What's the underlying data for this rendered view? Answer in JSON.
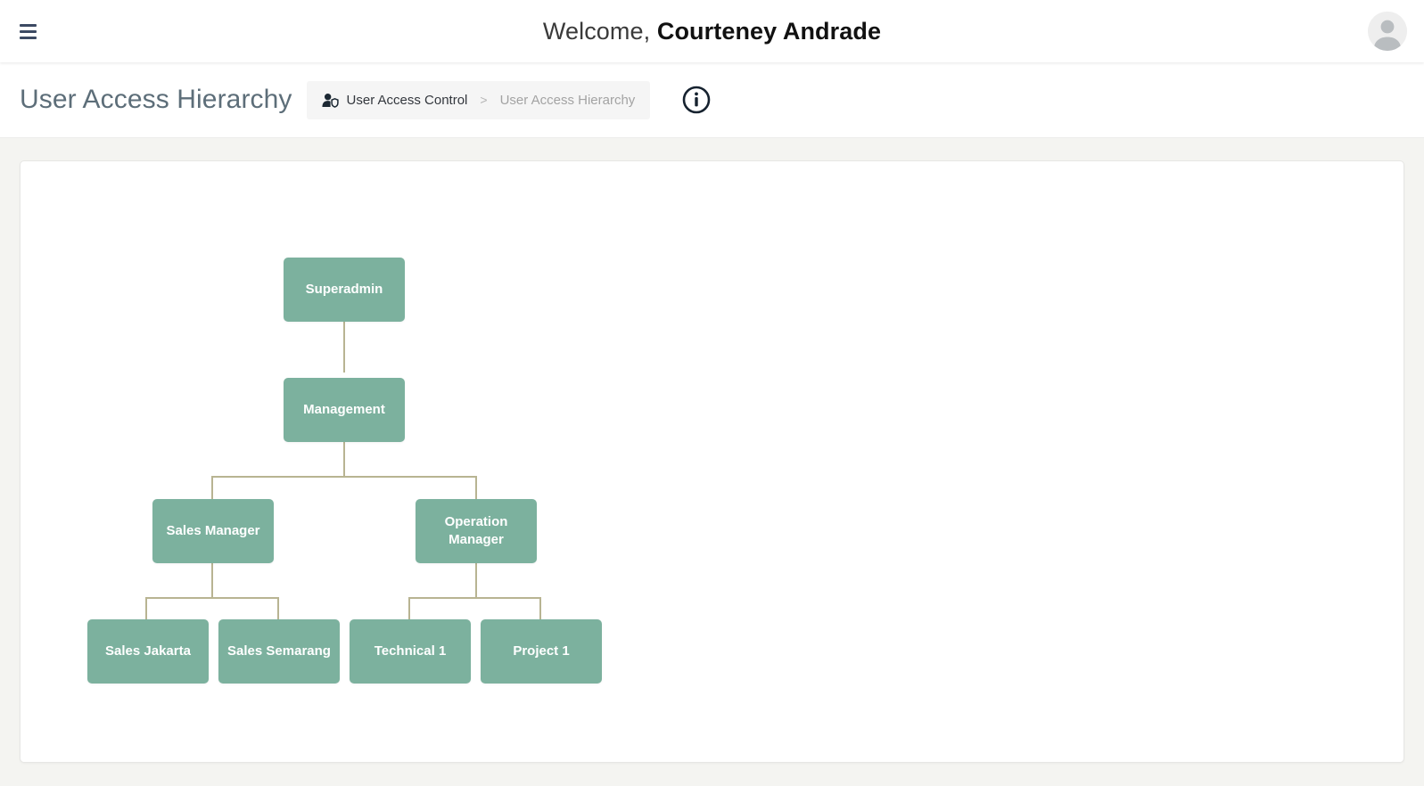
{
  "header": {
    "menu_icon": "hamburger-menu-icon",
    "welcome_prefix": "Welcome,",
    "user_name": "Courteney Andrade",
    "avatar_icon": "user-avatar-icon"
  },
  "subheader": {
    "page_title": "User Access Hierarchy",
    "breadcrumb": {
      "icon": "user-shield-icon",
      "parent": "User Access Control",
      "separator": ">",
      "current": "User Access Hierarchy"
    },
    "info_icon": "info-circle-icon"
  },
  "colors": {
    "node_fill": "#7cb19e",
    "node_text": "#ffffff",
    "connector": "#b8b492",
    "page_background": "#f4f4f1",
    "title_text": "#5d6e79",
    "menu_icon": "#3c4a63"
  },
  "chart_data": {
    "type": "diagram",
    "title": "User Access Hierarchy",
    "orientation": "top-down",
    "nodes": [
      {
        "id": "superadmin",
        "label": "Superadmin",
        "level": 0,
        "parent": null
      },
      {
        "id": "management",
        "label": "Management",
        "level": 1,
        "parent": "superadmin"
      },
      {
        "id": "sales-manager",
        "label": "Sales Manager",
        "level": 2,
        "parent": "management"
      },
      {
        "id": "operation-manager",
        "label": "Operation Manager",
        "level": 2,
        "parent": "management"
      },
      {
        "id": "sales-jakarta",
        "label": "Sales Jakarta",
        "level": 3,
        "parent": "sales-manager"
      },
      {
        "id": "sales-semarang",
        "label": "Sales Semarang",
        "level": 3,
        "parent": "sales-manager"
      },
      {
        "id": "technical-1",
        "label": "Technical 1",
        "level": 3,
        "parent": "operation-manager"
      },
      {
        "id": "project-1",
        "label": "Project 1",
        "level": 3,
        "parent": "operation-manager"
      }
    ]
  }
}
